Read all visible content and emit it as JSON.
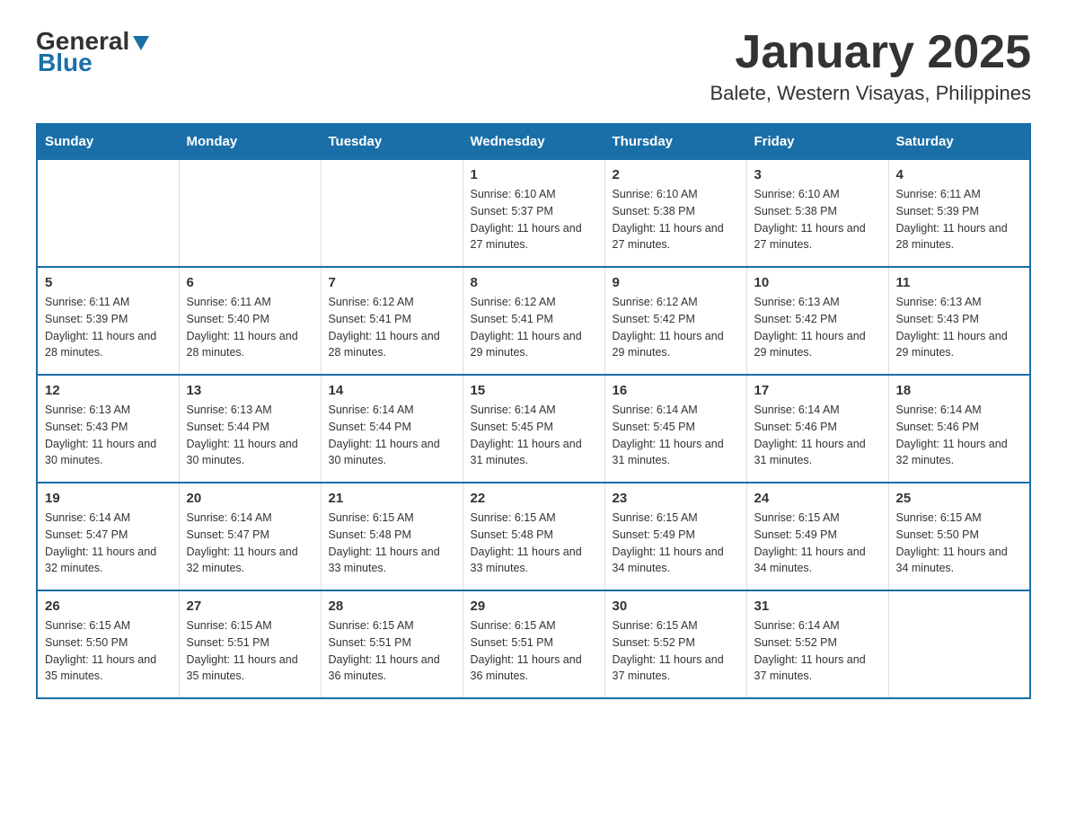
{
  "header": {
    "logo_general": "General",
    "logo_blue": "Blue",
    "month_title": "January 2025",
    "location": "Balete, Western Visayas, Philippines"
  },
  "days_of_week": [
    "Sunday",
    "Monday",
    "Tuesday",
    "Wednesday",
    "Thursday",
    "Friday",
    "Saturday"
  ],
  "weeks": [
    [
      {
        "day": "",
        "info": ""
      },
      {
        "day": "",
        "info": ""
      },
      {
        "day": "",
        "info": ""
      },
      {
        "day": "1",
        "info": "Sunrise: 6:10 AM\nSunset: 5:37 PM\nDaylight: 11 hours and 27 minutes."
      },
      {
        "day": "2",
        "info": "Sunrise: 6:10 AM\nSunset: 5:38 PM\nDaylight: 11 hours and 27 minutes."
      },
      {
        "day": "3",
        "info": "Sunrise: 6:10 AM\nSunset: 5:38 PM\nDaylight: 11 hours and 27 minutes."
      },
      {
        "day": "4",
        "info": "Sunrise: 6:11 AM\nSunset: 5:39 PM\nDaylight: 11 hours and 28 minutes."
      }
    ],
    [
      {
        "day": "5",
        "info": "Sunrise: 6:11 AM\nSunset: 5:39 PM\nDaylight: 11 hours and 28 minutes."
      },
      {
        "day": "6",
        "info": "Sunrise: 6:11 AM\nSunset: 5:40 PM\nDaylight: 11 hours and 28 minutes."
      },
      {
        "day": "7",
        "info": "Sunrise: 6:12 AM\nSunset: 5:41 PM\nDaylight: 11 hours and 28 minutes."
      },
      {
        "day": "8",
        "info": "Sunrise: 6:12 AM\nSunset: 5:41 PM\nDaylight: 11 hours and 29 minutes."
      },
      {
        "day": "9",
        "info": "Sunrise: 6:12 AM\nSunset: 5:42 PM\nDaylight: 11 hours and 29 minutes."
      },
      {
        "day": "10",
        "info": "Sunrise: 6:13 AM\nSunset: 5:42 PM\nDaylight: 11 hours and 29 minutes."
      },
      {
        "day": "11",
        "info": "Sunrise: 6:13 AM\nSunset: 5:43 PM\nDaylight: 11 hours and 29 minutes."
      }
    ],
    [
      {
        "day": "12",
        "info": "Sunrise: 6:13 AM\nSunset: 5:43 PM\nDaylight: 11 hours and 30 minutes."
      },
      {
        "day": "13",
        "info": "Sunrise: 6:13 AM\nSunset: 5:44 PM\nDaylight: 11 hours and 30 minutes."
      },
      {
        "day": "14",
        "info": "Sunrise: 6:14 AM\nSunset: 5:44 PM\nDaylight: 11 hours and 30 minutes."
      },
      {
        "day": "15",
        "info": "Sunrise: 6:14 AM\nSunset: 5:45 PM\nDaylight: 11 hours and 31 minutes."
      },
      {
        "day": "16",
        "info": "Sunrise: 6:14 AM\nSunset: 5:45 PM\nDaylight: 11 hours and 31 minutes."
      },
      {
        "day": "17",
        "info": "Sunrise: 6:14 AM\nSunset: 5:46 PM\nDaylight: 11 hours and 31 minutes."
      },
      {
        "day": "18",
        "info": "Sunrise: 6:14 AM\nSunset: 5:46 PM\nDaylight: 11 hours and 32 minutes."
      }
    ],
    [
      {
        "day": "19",
        "info": "Sunrise: 6:14 AM\nSunset: 5:47 PM\nDaylight: 11 hours and 32 minutes."
      },
      {
        "day": "20",
        "info": "Sunrise: 6:14 AM\nSunset: 5:47 PM\nDaylight: 11 hours and 32 minutes."
      },
      {
        "day": "21",
        "info": "Sunrise: 6:15 AM\nSunset: 5:48 PM\nDaylight: 11 hours and 33 minutes."
      },
      {
        "day": "22",
        "info": "Sunrise: 6:15 AM\nSunset: 5:48 PM\nDaylight: 11 hours and 33 minutes."
      },
      {
        "day": "23",
        "info": "Sunrise: 6:15 AM\nSunset: 5:49 PM\nDaylight: 11 hours and 34 minutes."
      },
      {
        "day": "24",
        "info": "Sunrise: 6:15 AM\nSunset: 5:49 PM\nDaylight: 11 hours and 34 minutes."
      },
      {
        "day": "25",
        "info": "Sunrise: 6:15 AM\nSunset: 5:50 PM\nDaylight: 11 hours and 34 minutes."
      }
    ],
    [
      {
        "day": "26",
        "info": "Sunrise: 6:15 AM\nSunset: 5:50 PM\nDaylight: 11 hours and 35 minutes."
      },
      {
        "day": "27",
        "info": "Sunrise: 6:15 AM\nSunset: 5:51 PM\nDaylight: 11 hours and 35 minutes."
      },
      {
        "day": "28",
        "info": "Sunrise: 6:15 AM\nSunset: 5:51 PM\nDaylight: 11 hours and 36 minutes."
      },
      {
        "day": "29",
        "info": "Sunrise: 6:15 AM\nSunset: 5:51 PM\nDaylight: 11 hours and 36 minutes."
      },
      {
        "day": "30",
        "info": "Sunrise: 6:15 AM\nSunset: 5:52 PM\nDaylight: 11 hours and 37 minutes."
      },
      {
        "day": "31",
        "info": "Sunrise: 6:14 AM\nSunset: 5:52 PM\nDaylight: 11 hours and 37 minutes."
      },
      {
        "day": "",
        "info": ""
      }
    ]
  ]
}
